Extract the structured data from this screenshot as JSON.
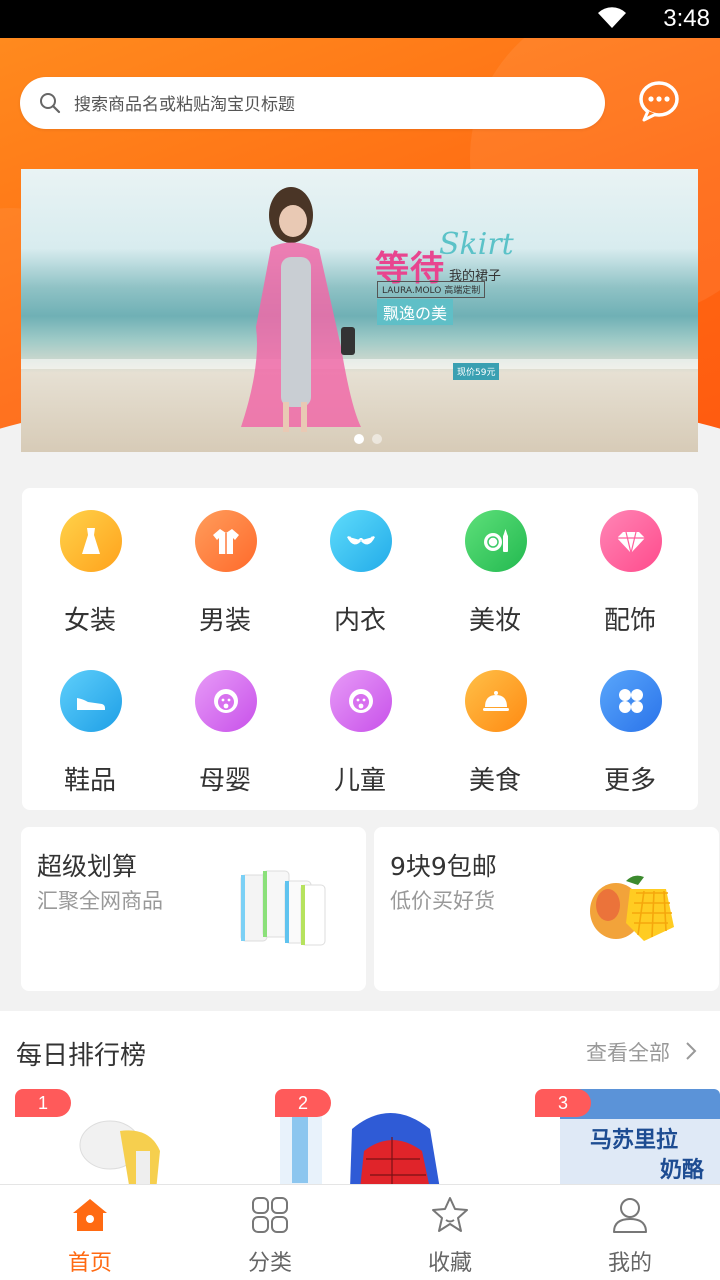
{
  "status_bar": {
    "time": "3:48"
  },
  "search": {
    "placeholder": "搜索商品名或粘贴淘宝贝标题"
  },
  "banner": {
    "title_cn": "等待",
    "title_en": "Skirt",
    "subtitle": "我的裙子",
    "brand": "LAURA.MOLO 高端定制",
    "tag": "飘逸の美",
    "price": "现价59元"
  },
  "categories": [
    {
      "label": "女装",
      "icon": "dress-icon",
      "color": "#ffb629"
    },
    {
      "label": "男装",
      "icon": "shirt-icon",
      "color": "#ff7a3d"
    },
    {
      "label": "内衣",
      "icon": "bra-icon",
      "color": "#35c3f0"
    },
    {
      "label": "美妆",
      "icon": "makeup-icon",
      "color": "#3ecb6a"
    },
    {
      "label": "配饰",
      "icon": "diamond-icon",
      "color": "#ff5e9c"
    },
    {
      "label": "鞋品",
      "icon": "shoe-icon",
      "color": "#2fb1ee"
    },
    {
      "label": "母婴",
      "icon": "baby-icon",
      "color": "#d870ef"
    },
    {
      "label": "儿童",
      "icon": "child-icon",
      "color": "#d870ef"
    },
    {
      "label": "美食",
      "icon": "food-cover-icon",
      "color": "#ff9d24"
    },
    {
      "label": "更多",
      "icon": "grid-more-icon",
      "color": "#3b8bf2"
    }
  ],
  "promos": [
    {
      "title": "超级划算",
      "subtitle": "汇聚全网商品"
    },
    {
      "title": "9块9包邮",
      "subtitle": "低价买好货"
    }
  ],
  "ranking": {
    "title": "每日排行榜",
    "more": "查看全部",
    "items": [
      {
        "rank": "1"
      },
      {
        "rank": "2"
      },
      {
        "rank": "3"
      }
    ]
  },
  "tabs": [
    {
      "label": "首页",
      "icon": "home-icon",
      "active": true
    },
    {
      "label": "分类",
      "icon": "category-icon",
      "active": false
    },
    {
      "label": "收藏",
      "icon": "star-icon",
      "active": false
    },
    {
      "label": "我的",
      "icon": "user-icon",
      "active": false
    }
  ],
  "colors": {
    "accent": "#ff6a12",
    "badge": "#ff5a5a"
  }
}
